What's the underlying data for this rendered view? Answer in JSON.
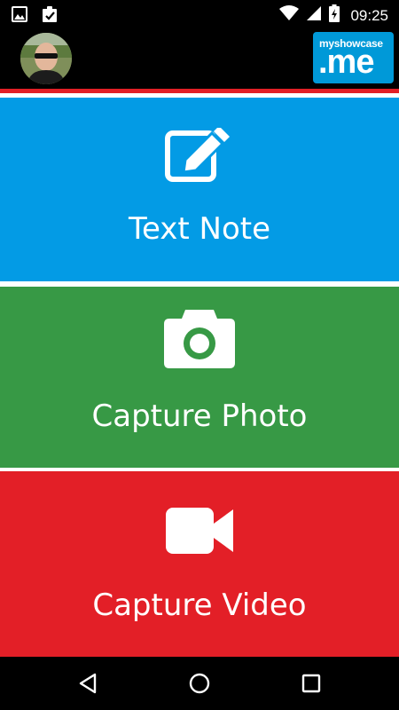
{
  "status_bar": {
    "time": "09:25",
    "icons": [
      "image-icon",
      "clipboard-check-icon",
      "wifi-icon",
      "signal-icon",
      "battery-charging-icon"
    ]
  },
  "header": {
    "avatar": "user-avatar",
    "logo": {
      "top_text": "myshowcase",
      "main_text": ".me"
    }
  },
  "actions": [
    {
      "label": "Text Note",
      "icon": "edit-note-icon",
      "color": "#039be5"
    },
    {
      "label": "Capture Photo",
      "icon": "camera-icon",
      "color": "#379945"
    },
    {
      "label": "Capture Video",
      "icon": "video-camera-icon",
      "color": "#e31f27"
    }
  ],
  "colors": {
    "accent_red": "#e21f26",
    "logo_blue": "#0099d8"
  },
  "nav_bar": {
    "icons": [
      "back-icon",
      "home-icon",
      "recents-icon"
    ]
  }
}
